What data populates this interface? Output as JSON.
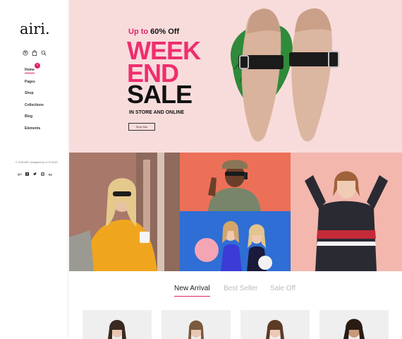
{
  "brand": {
    "logo": "airi."
  },
  "nav": {
    "items": [
      {
        "label": "Home"
      },
      {
        "label": "Pages"
      },
      {
        "label": "Shop"
      },
      {
        "label": "Collections"
      },
      {
        "label": "Blog"
      },
      {
        "label": "Elements"
      }
    ]
  },
  "header_icons": {
    "cart_count": "0"
  },
  "footer": {
    "copyright": "© 2018 AIRI. Designed by LA STUDIO"
  },
  "social": [
    "google-plus-icon",
    "facebook-icon",
    "twitter-icon",
    "instagram-icon",
    "behance-icon"
  ],
  "hero": {
    "upto_prefix": "Up to ",
    "upto_value": "60% Off",
    "line1": "WEEK",
    "line2": "END",
    "line3": "SALE",
    "subline": "IN STORE AND ONLINE",
    "button": "Shop Now"
  },
  "tabs": [
    {
      "label": "New Arrival"
    },
    {
      "label": "Best Seller"
    },
    {
      "label": "Sale Off"
    }
  ],
  "colors": {
    "accent": "#e0226b",
    "hero_bg": "#f8dcdc"
  }
}
